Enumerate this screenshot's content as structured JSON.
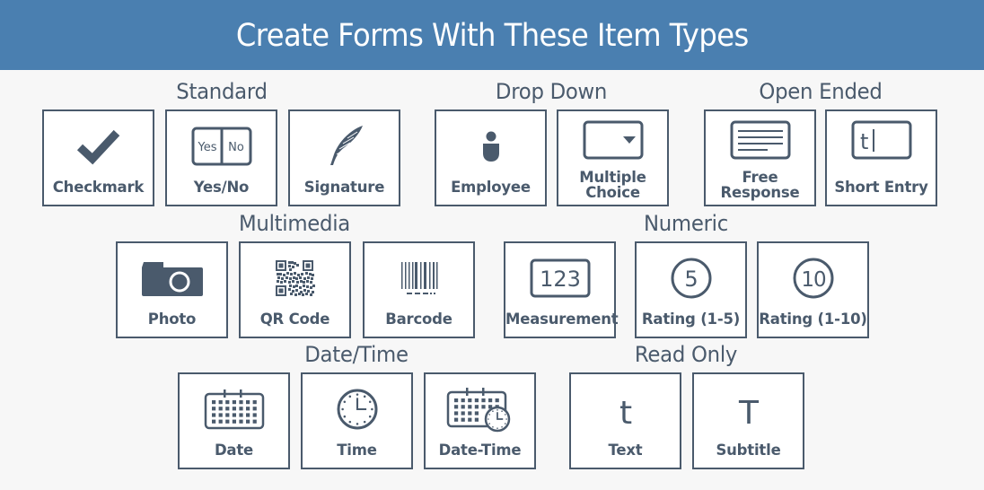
{
  "header": {
    "title": "Create Forms With These Item Types"
  },
  "colors": {
    "banner": "#4a7fb0",
    "ink": "#4a5a6c",
    "background": "#f7f7f7",
    "tile": "#ffffff"
  },
  "groups": [
    {
      "title": "Standard",
      "items": [
        {
          "label": "Checkmark",
          "icon": "checkmark-icon"
        },
        {
          "label": "Yes/No",
          "icon": "yes-no-toggle-icon",
          "icon_text": [
            "Yes",
            "No"
          ]
        },
        {
          "label": "Signature",
          "icon": "feather-quill-icon"
        }
      ]
    },
    {
      "title": "Drop Down",
      "items": [
        {
          "label": "Employee",
          "icon": "person-icon"
        },
        {
          "label": "Multiple Choice",
          "label_lines": [
            "Multiple",
            "Choice"
          ],
          "icon": "dropdown-select-icon"
        }
      ]
    },
    {
      "title": "Open Ended",
      "items": [
        {
          "label": "Free Response",
          "label_lines": [
            "Free",
            "Response"
          ],
          "icon": "text-area-icon"
        },
        {
          "label": "Short Entry",
          "icon": "text-input-icon",
          "icon_text": "t"
        }
      ]
    },
    {
      "title": "Multimedia",
      "items": [
        {
          "label": "Photo",
          "icon": "camera-icon"
        },
        {
          "label": "QR Code",
          "icon": "qr-code-icon"
        },
        {
          "label": "Barcode",
          "icon": "barcode-icon"
        }
      ]
    },
    {
      "title": "Numeric",
      "items": [
        {
          "label": "Measurement",
          "icon": "number-field-icon",
          "icon_text": "123"
        },
        {
          "label": "Rating (1-5)",
          "icon": "rating-circle-icon",
          "icon_text": "5"
        },
        {
          "label": "Rating (1-10)",
          "icon": "rating-circle-icon",
          "icon_text": "10"
        }
      ]
    },
    {
      "title": "Date/Time",
      "items": [
        {
          "label": "Date",
          "icon": "calendar-icon"
        },
        {
          "label": "Time",
          "icon": "clock-icon"
        },
        {
          "label": "Date-Time",
          "icon": "calendar-clock-icon"
        }
      ]
    },
    {
      "title": "Read Only",
      "items": [
        {
          "label": "Text",
          "icon": "lowercase-t-icon",
          "icon_text": "t"
        },
        {
          "label": "Subtitle",
          "icon": "uppercase-t-icon",
          "icon_text": "T"
        }
      ]
    }
  ]
}
